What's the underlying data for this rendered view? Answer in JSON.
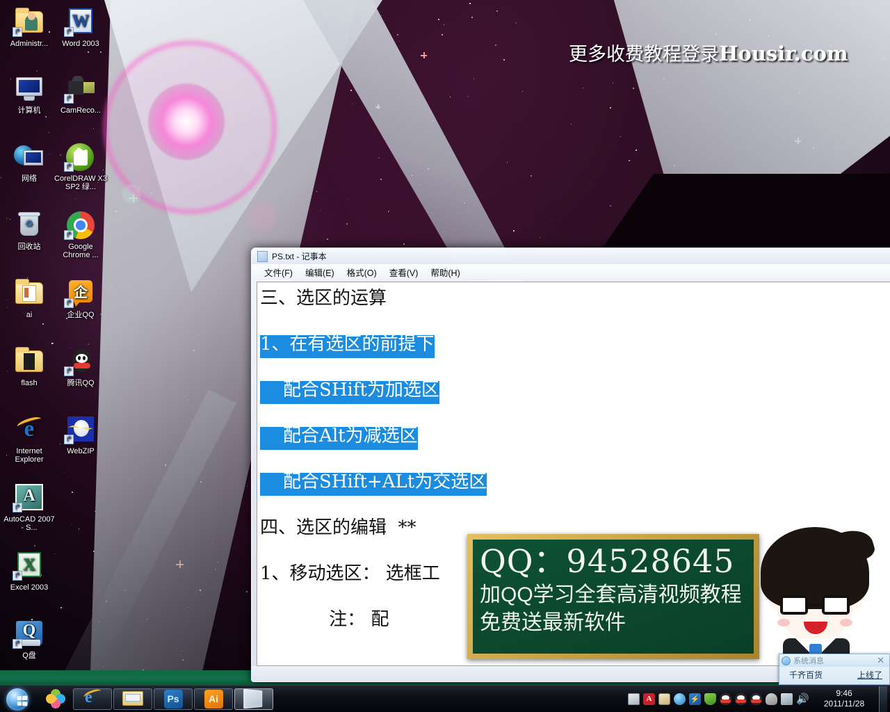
{
  "desktop": {
    "watermark": {
      "text_cn": "更多收费教程登录",
      "domain": "Housir.com"
    },
    "icons": [
      {
        "name": "Administr...",
        "label": "Administr...",
        "type": "folder-user"
      },
      {
        "name": "Word 2003",
        "label": "Word 2003",
        "type": "word"
      },
      {
        "name": "计算机",
        "label": "计算机",
        "type": "computer"
      },
      {
        "name": "CamReco...",
        "label": "CamReco...",
        "type": "camrecorder"
      },
      {
        "name": "网络",
        "label": "网络",
        "type": "network"
      },
      {
        "name": "CorelDRAW X3 SP2 绿...",
        "label": "CorelDRAW X3 SP2 绿...",
        "type": "coreldraw"
      },
      {
        "name": "回收站",
        "label": "回收站",
        "type": "recycle-bin"
      },
      {
        "name": "Google Chrome ...",
        "label": "Google Chrome ...",
        "type": "chrome"
      },
      {
        "name": "ai",
        "label": "ai",
        "type": "folder-open"
      },
      {
        "name": "企业QQ",
        "label": "企业QQ",
        "type": "qiye-qq"
      },
      {
        "name": "flash",
        "label": "flash",
        "type": "folder-dark"
      },
      {
        "name": "腾讯QQ",
        "label": "腾讯QQ",
        "type": "tencent-qq"
      },
      {
        "name": "Internet Explorer",
        "label": "Internet Explorer",
        "type": "ie"
      },
      {
        "name": "WebZIP",
        "label": "WebZIP",
        "type": "webzip"
      },
      {
        "name": "AutoCAD 2007 - S...",
        "label": "AutoCAD 2007 - S...",
        "type": "autocad"
      },
      {
        "name": "Excel 2003",
        "label": "Excel 2003",
        "type": "excel"
      },
      {
        "name": "Q盘",
        "label": "Q盘",
        "type": "qpan"
      }
    ]
  },
  "notepad": {
    "title": "PS.txt - 记事本",
    "menu": [
      {
        "label": "文件(F)"
      },
      {
        "label": "编辑(E)"
      },
      {
        "label": "格式(O)"
      },
      {
        "label": "查看(V)"
      },
      {
        "label": "帮助(H)"
      }
    ],
    "lines": [
      {
        "text": "三、选区的运算",
        "selected": false
      },
      {
        "text": "",
        "selected": false
      },
      {
        "text": "1、在有选区的前提下",
        "selected": true
      },
      {
        "text": "",
        "selected": false
      },
      {
        "text": "    配合SHift为加选区",
        "selected": true
      },
      {
        "text": "",
        "selected": false
      },
      {
        "text": "    配合Alt为减选区",
        "selected": true
      },
      {
        "text": "",
        "selected": false
      },
      {
        "text": "    配合SHift+ALt为交选区",
        "selected": true
      },
      {
        "text": "",
        "selected": false
      },
      {
        "text": "四、选区的编辑  **",
        "selected": false
      },
      {
        "text": "",
        "selected": false
      },
      {
        "text": "1、移动选区： 选框工",
        "selected": false
      },
      {
        "text": "",
        "selected": false
      },
      {
        "text": "            注： 配",
        "selected": false
      }
    ],
    "selection_color": "#1c8ce0",
    "selection_text_color": "#ffffff"
  },
  "qq_ad": {
    "line1": "QQ：94528645",
    "line2": "加QQ学习全套高清视频教程",
    "line3": "免费送最新软件",
    "board_color": "#0e5234",
    "frame_color": "#c9a23a"
  },
  "qq_popup": {
    "title": "系统消息",
    "close": "✕",
    "sender": "千齐百货",
    "status": "上线了"
  },
  "taskbar": {
    "start_tooltip": "开始",
    "quick_launch": [
      {
        "name": "qq-flower",
        "label": "QQ"
      },
      {
        "name": "internet-explorer",
        "label": "Internet Explorer"
      },
      {
        "name": "windows-explorer",
        "label": "Windows 资源管理器"
      },
      {
        "name": "photoshop",
        "label": "Ps"
      },
      {
        "name": "illustrator",
        "label": "Ai"
      },
      {
        "name": "photo-viewer",
        "label": "图片查看器"
      }
    ],
    "tray_icons": [
      {
        "name": "ime-keyboard-icon"
      },
      {
        "name": "adobe-updater-icon"
      },
      {
        "name": "notes-icon"
      },
      {
        "name": "blue-ball-icon"
      },
      {
        "name": "thunder-icon"
      },
      {
        "name": "shield-icon"
      },
      {
        "name": "qq-penguin-1-icon"
      },
      {
        "name": "qq-penguin-2-icon"
      },
      {
        "name": "qq-penguin-3-icon"
      },
      {
        "name": "person-red-icon"
      },
      {
        "name": "network-icon"
      },
      {
        "name": "volume-icon"
      }
    ],
    "clock": {
      "time": "9:46",
      "date": "2011/11/28"
    }
  }
}
